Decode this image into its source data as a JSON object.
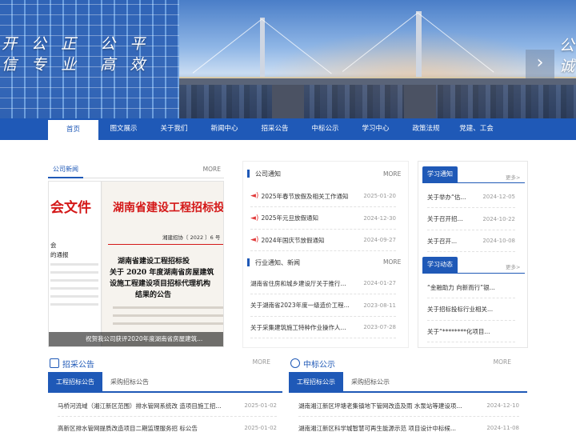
{
  "banner": {
    "slogan_left": "开 公 正  公 平\n信 专 业  高 效",
    "slogan_right": "公\n诚",
    "next_glyph": "›"
  },
  "nav": {
    "items": [
      "首页",
      "图文展示",
      "关于我们",
      "新闻中心",
      "招采公告",
      "中标公示",
      "学习中心",
      "政策法规",
      "党建、工会"
    ],
    "active_index": 0
  },
  "company_news": {
    "tab": "公司新闻",
    "more": "MORE",
    "photo": {
      "left_heading": "会文件",
      "left_lines": [
        "会",
        "的通报"
      ],
      "doc_title": "湖南省建设工程招标投标",
      "doc_number": "湘建招协〔 2022 〕6 号",
      "doc_headlines": [
        "湖南省建设工程招标投",
        "关于 2020 年度湖南省房屋建筑",
        "设施工程建设项目招标代理机构",
        "结果的公告"
      ],
      "caption": "祝贺我公司获评2020年度湖南省房屋建筑..."
    }
  },
  "notices": {
    "title": "公司通知",
    "more": "MORE",
    "items": [
      {
        "title": "2025年春节放假及相关工作通知",
        "date": "2025-01-20"
      },
      {
        "title": "2025年元旦放假通知",
        "date": "2024-12-30"
      },
      {
        "title": "2024年国庆节放假通知",
        "date": "2024-09-27"
      }
    ]
  },
  "industry": {
    "title": "行业通知、新闻",
    "more": "MORE",
    "items": [
      {
        "title": "湖南省住房和城乡建设厅关于推行...",
        "date": "2024-01-27"
      },
      {
        "title": "关于湖南省2023年度一级造价工程...",
        "date": "2023-08-11"
      },
      {
        "title": "关于采集建筑施工特种作业操作人...",
        "date": "2023-07-28"
      }
    ]
  },
  "study_notice": {
    "tab": "学习通知",
    "more": "更多>",
    "items": [
      {
        "title": "关于举办“估...",
        "date": "2024-12-05"
      },
      {
        "title": "关于召开招...",
        "date": "2024-10-22"
      },
      {
        "title": "关于召开...",
        "date": "2024-10-08"
      }
    ]
  },
  "study_news": {
    "tab": "学习动态",
    "more": "更多>",
    "items": [
      {
        "title": "“金融助力 向新而行”银..."
      },
      {
        "title": "关于招标投标行业相关..."
      },
      {
        "title": "关于“********化项目..."
      }
    ]
  },
  "tender": {
    "title": "招采公告",
    "more": "MORE",
    "tabs": [
      "工程招标公告",
      "采购招标公告"
    ],
    "items": [
      {
        "title": "马桥河流域（湘江新区范围）排水管网系统改 造项目施工招...",
        "date": "2025-01-02"
      },
      {
        "title": "高新区排水管网提质改造项目二期监理服务招 标公告",
        "date": "2025-01-02"
      }
    ]
  },
  "award": {
    "title": "中标公示",
    "more": "MORE",
    "tabs": [
      "工程招标公示",
      "采购招标公示"
    ],
    "items": [
      {
        "title": "湖南湘江新区坪塘老集镇地下管网改造及雨 水泵站等建设项...",
        "date": "2024-12-10"
      },
      {
        "title": "湖南湘江新区科学城智慧可再生能源示范 项目设计中标候...",
        "date": "2024-11-08"
      }
    ]
  }
}
